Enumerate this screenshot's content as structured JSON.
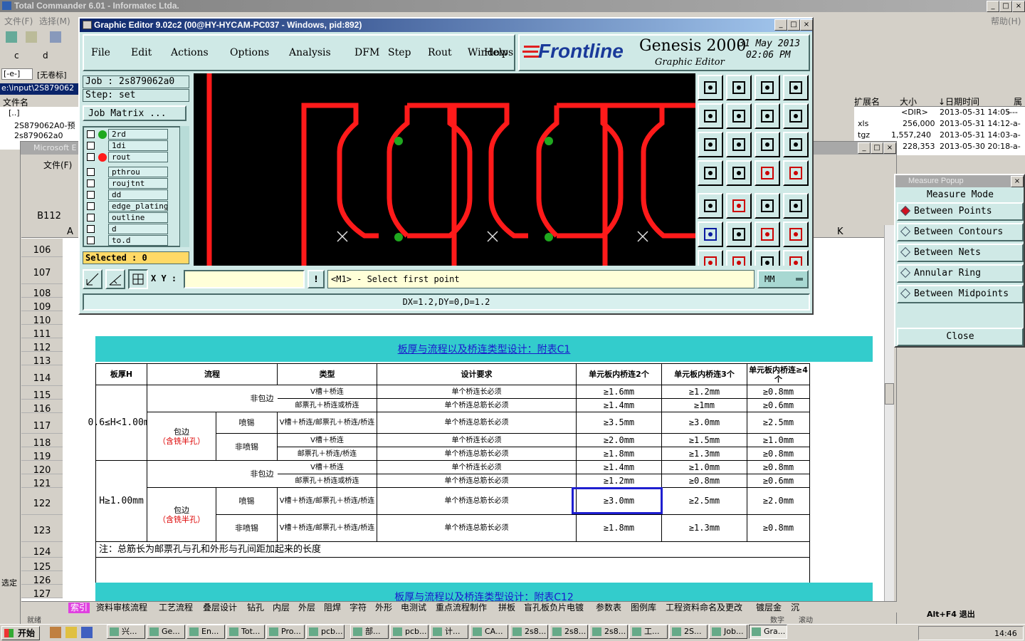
{
  "tc": {
    "title": "Total Commander 6.01 - Informatec Ltda.",
    "menu": [
      "文件(F)",
      "选择(M)"
    ],
    "help": "帮助(H)",
    "drive_c": "c",
    "drive_d": "d",
    "drive_combo": "[-e-]",
    "label_combo": "[无卷标]",
    "path": "e:\\input\\2S879062",
    "col_name": "文件名",
    "col_ext": "扩展名",
    "col_size": "大小",
    "col_date": "↓日期时间",
    "col_attr": "属",
    "files": [
      {
        "name": "[..]",
        "ext": "",
        "size": "<DIR>",
        "date": "2013-05-31 14:05",
        "attr": "----"
      },
      {
        "name": "2S879062A0-预",
        "ext": "xls",
        "size": "256,000",
        "date": "2013-05-31 14:12",
        "attr": "-a-"
      },
      {
        "name": "2s879062a0",
        "ext": "tgz",
        "size": "1,557,240",
        "date": "2013-05-31 14:03",
        "attr": "-a-"
      },
      {
        "name": "",
        "ext": "",
        "size": "228,353",
        "date": "2013-05-30 20:18",
        "attr": "-a-"
      }
    ],
    "side_label": "选定",
    "altf4": "Alt+F4 退出"
  },
  "excel": {
    "title": "Microsoft E",
    "menu_file": "文件(F)",
    "cellref": "B112",
    "col_a": "A",
    "col_k": "K",
    "rows": [
      "106",
      "107",
      "108",
      "109",
      "110",
      "111",
      "112",
      "113",
      "114",
      "115",
      "116",
      "117",
      "118",
      "119",
      "120",
      "121",
      "122",
      "123",
      "124",
      "125",
      "126",
      "127"
    ],
    "section_title": "板厚与流程以及桥连类型设计：附表C1",
    "section_title2": "板厚与流程以及桥连类型设计：附表C12",
    "headers": [
      "板厚H",
      "流程",
      "类型",
      "设计要求",
      "单元板内桥连2个",
      "单元板内桥连3个",
      "单元板内桥连≥4个"
    ],
    "t1": "0.6≤H<1.00mm",
    "t2": "H≥1.00mm",
    "non_wrap": "非包边",
    "wrap": "包边",
    "wrap_note": "（含铣半孔）",
    "spray": "喷锡",
    "nospray": "非喷锡",
    "types": [
      "V槽＋桥连",
      "邮票孔＋桥连或桥连",
      "V槽＋桥连/邮票孔＋桥连/桥连",
      "V槽＋桥连",
      "邮票孔＋桥连/桥连",
      "V槽＋桥连",
      "邮票孔＋桥连或桥连",
      "V槽＋桥连/邮票孔＋桥连/桥连",
      "V槽＋桥连/邮票孔＋桥连/桥连"
    ],
    "reqs": [
      "单个桥连长必须",
      "单个桥连总筋长必须",
      "单个桥连总筋长必须",
      "单个桥连长必须",
      "单个桥连总筋长必须",
      "单个桥连长必须",
      "单个桥连总筋长必须",
      "单个桥连总筋长必须",
      "单个桥连总筋长必须"
    ],
    "v2": [
      "≥1.6mm",
      "≥1.4mm",
      "≥3.5mm",
      "≥2.0mm",
      "≥1.8mm",
      "≥1.4mm",
      "≥1.2mm",
      "≥3.0mm",
      "≥1.8mm"
    ],
    "v3": [
      "≥1.2mm",
      "≥1mm",
      "≥3.0mm",
      "≥1.5mm",
      "≥1.3mm",
      "≥1.0mm",
      "≥0.8mm",
      "≥2.5mm",
      "≥1.3mm"
    ],
    "v4": [
      "≥0.8mm",
      "≥0.6mm",
      "≥2.5mm",
      "≥1.0mm",
      "≥0.8mm",
      "≥0.8mm",
      "≥0.6mm",
      "≥2.0mm",
      "≥0.8mm"
    ],
    "note": "注：总筋长为邮票孔与孔和外形与孔间距加起来的长度",
    "sheet_tabs": [
      "索引",
      "资料审核流程",
      "工艺流程",
      "叠层设计",
      "钻孔",
      "内层",
      "外层",
      "阻焊",
      "字符",
      "外形",
      "电测试",
      "重点流程制作",
      "拼板",
      "盲孔板负片电镀",
      "参数表",
      "图例库",
      "工程资料命名及更改",
      "镀层金",
      "沉"
    ],
    "status_left": "就绪",
    "status_mid": "数字",
    "status_right": "滚动"
  },
  "genesis": {
    "title": "Graphic Editor 9.02c2 (00@HY-HYCAM-PC037 - Windows, pid:892)",
    "menu": [
      "File",
      "Edit",
      "Actions",
      "Options",
      "Analysis",
      "DFM",
      "Step",
      "Rout",
      "Windows"
    ],
    "help": "Help",
    "brand": "Frontline",
    "product": "Genesis 2000",
    "subtitle": "Graphic Editor",
    "date": "31 May 2013",
    "time": "02:06 PM",
    "job": "Job : 2s879062a0",
    "step": "Step: set",
    "job_matrix": "Job Matrix ...",
    "layers": [
      "2rd",
      "1di",
      "rout",
      "pthrou",
      "roujtnt",
      "dd",
      "edge_plating",
      "outline",
      "d",
      "to.d"
    ],
    "selected": "Selected : 0",
    "xy_label": "X Y :",
    "xy_value": "",
    "prompt": "<M1> - Select first point",
    "units": "MM",
    "measure": "DX=1.2,DY=0,D=1.2"
  },
  "measure_popup": {
    "title": "Measure Popup",
    "mode": "Measure Mode",
    "items": [
      "Between Points",
      "Between Contours",
      "Between Nets",
      "Annular Ring",
      "Between Midpoints"
    ],
    "close": "Close"
  },
  "taskbar": {
    "start": "开始",
    "tasks": [
      "兴...",
      "Ge...",
      "En...",
      "Tot...",
      "Pro...",
      "pcb...",
      "部...",
      "pcb...",
      "计...",
      "CA...",
      "2s8...",
      "2s8...",
      "2s8...",
      "工...",
      "2S...",
      "Job...",
      "Gra..."
    ],
    "clock": "14:46"
  },
  "colors": {
    "genesis_bg": "#cfe9e6",
    "canvas": "#000000",
    "trace": "#ff1a1a",
    "pad": "#1fa81f",
    "excel_band": "#33cccc",
    "highlight": "#1f1fd0",
    "link": "#1a1acc"
  }
}
